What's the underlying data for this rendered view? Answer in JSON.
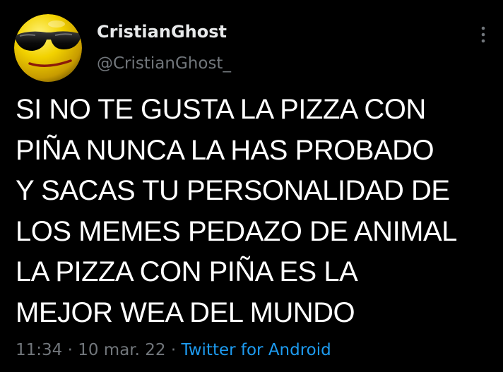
{
  "author": {
    "display_name": "CristianGhost",
    "handle": "@CristianGhost_",
    "avatar_icon": "sunglasses-smiley-avatar"
  },
  "more_icon": "more-vertical-icon",
  "tweet": {
    "lines": [
      "SI NO TE GUSTA LA PIZZA CON",
      "PIÑA NUNCA LA HAS PROBADO",
      "Y SACAS TU PERSONALIDAD DE",
      "LOS MEMES PEDAZO DE ANIMAL",
      "LA PIZZA CON PIÑA ES LA",
      "MEJOR WEA DEL MUNDO"
    ]
  },
  "meta": {
    "time": "11:34",
    "separator": "·",
    "date": "10 mar. 22",
    "source": "Twitter for Android"
  },
  "colors": {
    "background": "#000000",
    "text": "#ffffff",
    "secondary": "#71767b",
    "link": "#1d9bf0",
    "avatar_yellow": "#f2d200"
  }
}
